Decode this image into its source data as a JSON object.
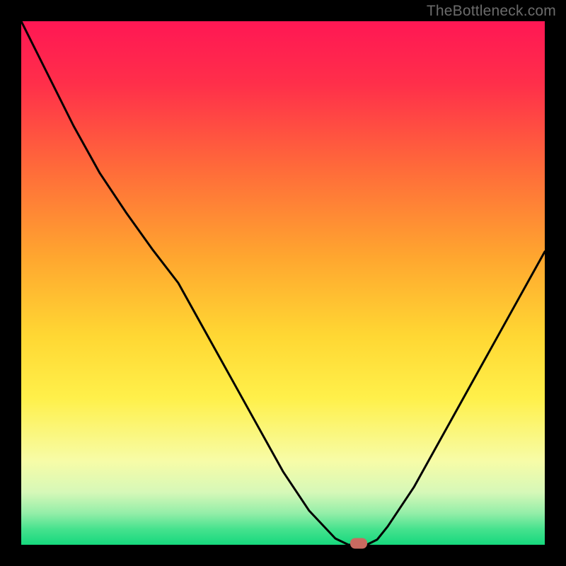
{
  "watermark": "TheBottleneck.com",
  "chart_data": {
    "type": "line",
    "title": "",
    "xlabel": "",
    "ylabel": "",
    "x": [
      0.0,
      0.05,
      0.1,
      0.15,
      0.2,
      0.25,
      0.3,
      0.35,
      0.4,
      0.45,
      0.5,
      0.55,
      0.6,
      0.625,
      0.66,
      0.68,
      0.7,
      0.75,
      0.8,
      0.85,
      0.9,
      0.95,
      1.0
    ],
    "values": [
      1.0,
      0.9,
      0.8,
      0.71,
      0.635,
      0.565,
      0.5,
      0.41,
      0.32,
      0.23,
      0.14,
      0.065,
      0.012,
      0.0,
      0.0,
      0.01,
      0.035,
      0.11,
      0.2,
      0.29,
      0.38,
      0.47,
      0.56
    ],
    "xlim": [
      0,
      1
    ],
    "ylim": [
      0,
      1
    ],
    "marker": {
      "x": 0.645,
      "y": 0.003
    },
    "gradient_stops": [
      {
        "offset": 0.0,
        "color": "#ff1754"
      },
      {
        "offset": 0.12,
        "color": "#ff2f4a"
      },
      {
        "offset": 0.28,
        "color": "#ff6a3a"
      },
      {
        "offset": 0.45,
        "color": "#ffa62f"
      },
      {
        "offset": 0.6,
        "color": "#ffd733"
      },
      {
        "offset": 0.72,
        "color": "#fff04a"
      },
      {
        "offset": 0.84,
        "color": "#f7fca7"
      },
      {
        "offset": 0.9,
        "color": "#d6f8b8"
      },
      {
        "offset": 0.94,
        "color": "#93eea8"
      },
      {
        "offset": 0.97,
        "color": "#46e28e"
      },
      {
        "offset": 1.0,
        "color": "#16d87d"
      }
    ]
  }
}
